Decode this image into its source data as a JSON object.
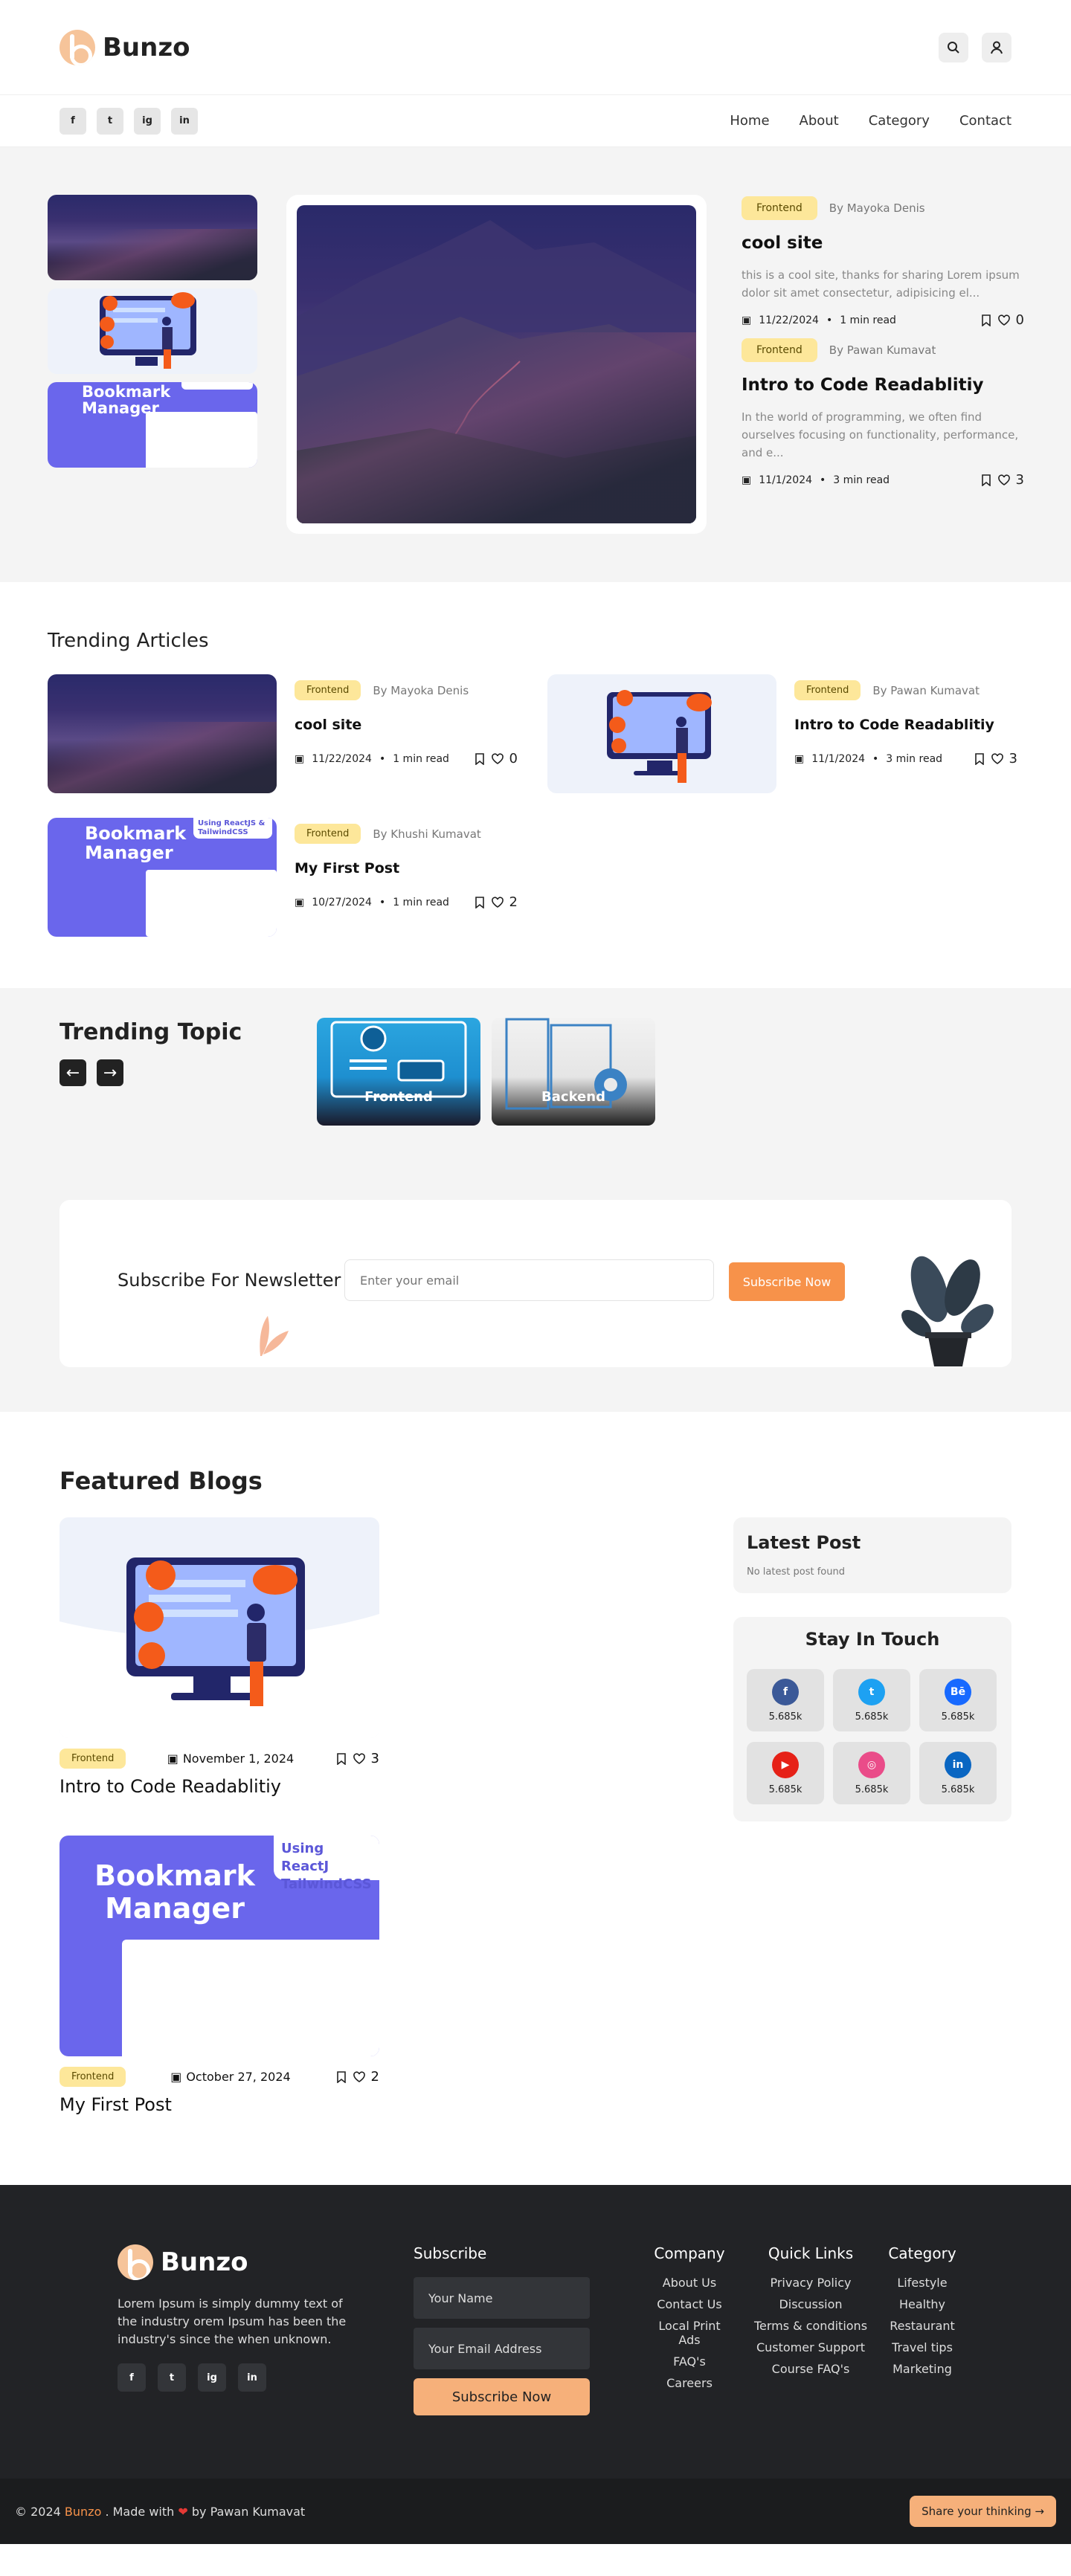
{
  "header": {
    "brand": "Bunzo",
    "search_icon": "search-icon",
    "user_icon": "user-icon"
  },
  "nav": {
    "social": [
      "f",
      "t",
      "ig",
      "in"
    ],
    "links": [
      "Home",
      "About",
      "Category",
      "Contact"
    ]
  },
  "hero": {
    "posts": [
      {
        "tag": "Frontend",
        "author": "By Mayoka Denis",
        "title": "cool site",
        "excerpt": "this is a cool site, thanks for sharing Lorem ipsum dolor sit amet consectetur, adipisicing el...",
        "date": "11/22/2024",
        "read": "1 min read",
        "likes": "0"
      },
      {
        "tag": "Frontend",
        "author": "By Pawan Kumavat",
        "title": "Intro to Code Readablitiy",
        "excerpt": "In the world of programming, we often find ourselves focusing on functionality, performance, and e...",
        "date": "11/1/2024",
        "read": "3 min read",
        "likes": "3"
      }
    ],
    "thumb_text": "Bookmark Manager"
  },
  "trending": {
    "title": "Trending Articles",
    "items": [
      {
        "tag": "Frontend",
        "author": "By Mayoka Denis",
        "title": "cool site",
        "date": "11/22/2024",
        "read": "1 min read",
        "likes": "0"
      },
      {
        "tag": "Frontend",
        "author": "By Pawan Kumavat",
        "title": "Intro to Code Readablitiy",
        "date": "11/1/2024",
        "read": "3 min read",
        "likes": "3"
      },
      {
        "tag": "Frontend",
        "author": "By Khushi Kumavat",
        "title": "My First Post",
        "date": "10/27/2024",
        "read": "1 min read",
        "likes": "2"
      }
    ],
    "bm_title": "Bookmark Manager",
    "bm_sub": "Using ReactJS & TailwindCSS"
  },
  "topics": {
    "title": "Trending Topic",
    "prev": "←",
    "next": "→",
    "cats": [
      "Frontend",
      "Backend"
    ]
  },
  "newsletter": {
    "title": "Subscribe For Newsletter",
    "placeholder": "Enter your email",
    "button": "Subscribe Now"
  },
  "featured": {
    "title": "Featured Blogs",
    "posts": [
      {
        "tag": "Frontend",
        "date": "November 1, 2024",
        "likes": "3",
        "title": "Intro to Code Readablitiy"
      },
      {
        "tag": "Frontend",
        "date": "October 27, 2024",
        "likes": "2",
        "title": "My First Post"
      }
    ],
    "bm_title": "Bookmark Manager",
    "bm_sub": "Using ReactJ TailwindCSS",
    "latest_title": "Latest Post",
    "latest_empty": "No latest post found",
    "touch_title": "Stay In Touch",
    "social": [
      {
        "icon": "f",
        "count": "5.685k",
        "color": "#3b5998"
      },
      {
        "icon": "t",
        "count": "5.685k",
        "color": "#1da1f2"
      },
      {
        "icon": "Bē",
        "count": "5.685k",
        "color": "#1769ff"
      },
      {
        "icon": "▶",
        "count": "5.685k",
        "color": "#e62117"
      },
      {
        "icon": "◎",
        "count": "5.685k",
        "color": "#ea4c89"
      },
      {
        "icon": "in",
        "count": "5.685k",
        "color": "#0a66c2"
      }
    ]
  },
  "footer": {
    "brand": "Bunzo",
    "about": "Lorem Ipsum is simply dummy text of the industry orem Ipsum has been the industry's since the when unknown.",
    "social": [
      "f",
      "t",
      "ig",
      "in"
    ],
    "subscribe": {
      "title": "Subscribe",
      "name": "Your Name",
      "email": "Your Email Address",
      "button": "Subscribe Now"
    },
    "cols": [
      {
        "title": "Company",
        "items": [
          "About Us",
          "Contact Us",
          "Local Print Ads",
          "FAQ's",
          "Careers"
        ]
      },
      {
        "title": "Quick Links",
        "items": [
          "Privacy Policy",
          "Discussion",
          "Terms & conditions",
          "Customer Support",
          "Course FAQ's"
        ]
      },
      {
        "title": "Category",
        "items": [
          "Lifestyle",
          "Healthy",
          "Restaurant",
          "Travel tips",
          "Marketing"
        ]
      }
    ],
    "copy_prefix": "© 2024",
    "copy_brand": "Bunzo",
    "copy_made": ". Made with",
    "copy_by": "by Pawan Kumavat",
    "share": "Share your thinking →"
  }
}
